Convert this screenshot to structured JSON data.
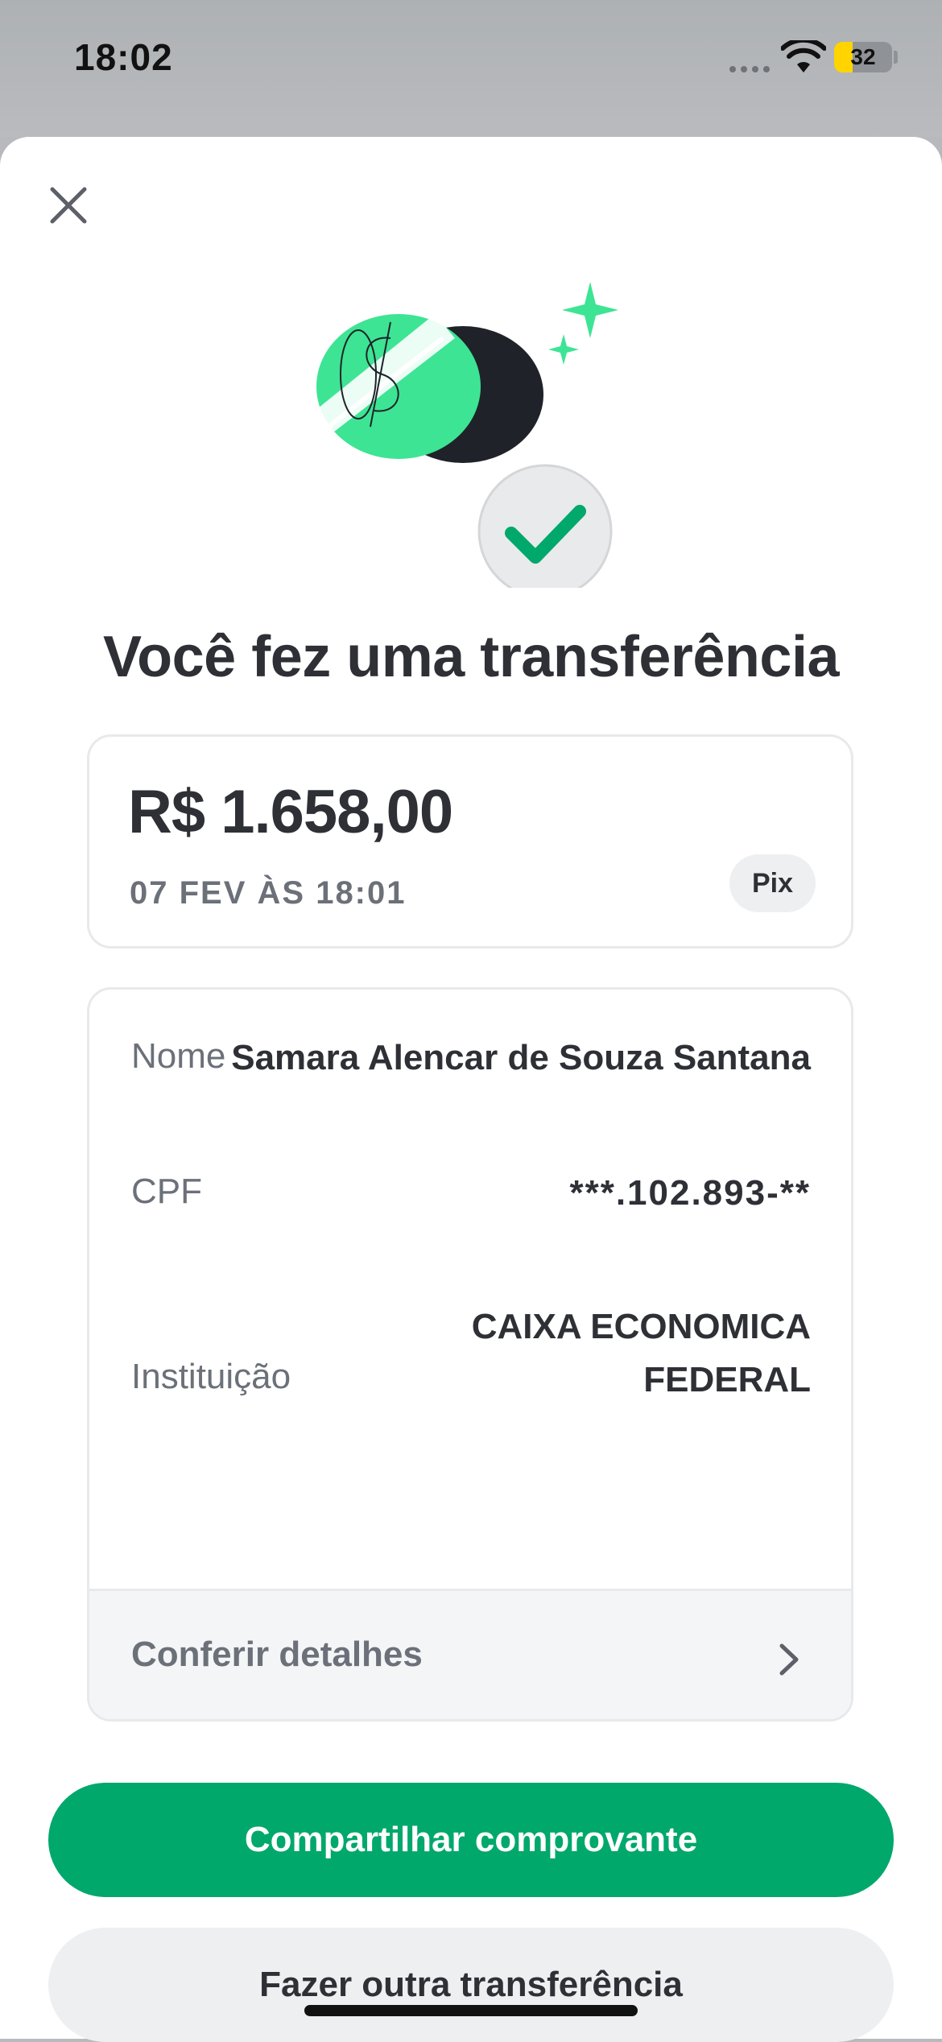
{
  "status_bar": {
    "time": "18:02",
    "battery_percent": "32",
    "battery_level": 0.32,
    "battery_color": "#ffd400"
  },
  "icons": {
    "close": "close-icon",
    "hero": "money-check-illustration",
    "chevron": "chevron-right-icon",
    "wifi": "wifi-icon"
  },
  "sheet": {
    "title": "Você fez uma transferência"
  },
  "amount_card": {
    "amount": "R$ 1.658,00",
    "date": "07 FEV ÀS 18:01",
    "method_badge": "Pix"
  },
  "details": {
    "rows": [
      {
        "label": "Nome",
        "value": "Samara Alencar de Souza Santana"
      },
      {
        "label": "CPF",
        "value": "***.102.893-**"
      },
      {
        "label": "Instituição",
        "value": "CAIXA ECONOMICA FEDERAL"
      }
    ],
    "footer_link": "Conferir detalhes"
  },
  "actions": {
    "primary": "Compartilhar comprovante",
    "secondary": "Fazer outra transferência"
  },
  "colors": {
    "accent_green": "#00a86b",
    "illustration_green": "#3de494",
    "text_dark": "#2e3036",
    "text_muted": "#6b7079"
  }
}
